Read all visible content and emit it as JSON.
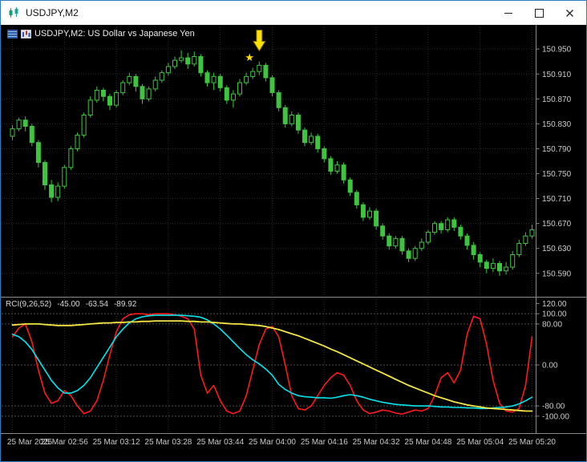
{
  "window": {
    "title": "USDJPY,M2",
    "icon": "chart-window-icon",
    "controls": [
      "minimize",
      "maximize",
      "close"
    ]
  },
  "chart": {
    "symbol_label": "USDJPY,M2:  US Dollar vs Japanese Yen",
    "corner_icons": [
      "grid-icon",
      "candles-icon"
    ],
    "indicator": {
      "name": "RCI(9,26,52)",
      "value1": "-45.00",
      "value2": "-63.54",
      "value3": "-89.92"
    }
  },
  "chart_data": {
    "type": "candlestick",
    "symbol": "USDJPY",
    "timeframe": "M2",
    "title": "USDJPY,M2: US Dollar vs Japanese Yen",
    "colors": {
      "background": "#000000",
      "bull_fill": "#000000",
      "bear_fill": "#3FC43F",
      "candle_border": "#3FC43F",
      "grid": "#2D2D2D",
      "level": "#4F4F4F",
      "separator": "#8A8A8A",
      "axis_text": "#CCCCCC"
    },
    "price_pane": {
      "ylim": [
        150.555,
        150.985
      ],
      "grid_labels": [
        "150.950",
        "150.910",
        "150.870",
        "150.830",
        "150.790",
        "150.750",
        "150.710",
        "150.670",
        "150.630",
        "150.590"
      ]
    },
    "time_axis": {
      "candles_per_label": 8,
      "labels": [
        "25 Mar 2025",
        "25 Mar 02:56",
        "25 Mar 03:12",
        "25 Mar 03:28",
        "25 Mar 03:44",
        "25 Mar 04:00",
        "25 Mar 04:16",
        "25 Mar 04:32",
        "25 Mar 04:48",
        "25 Mar 05:04",
        "25 Mar 05:20"
      ]
    },
    "candles": [
      [
        150.81,
        150.828,
        150.804,
        150.822
      ],
      [
        150.822,
        150.84,
        150.818,
        150.836
      ],
      [
        150.836,
        150.842,
        150.818,
        150.826
      ],
      [
        150.826,
        150.83,
        150.794,
        150.8
      ],
      [
        150.8,
        150.804,
        150.76,
        150.768
      ],
      [
        150.768,
        150.772,
        150.724,
        150.732
      ],
      [
        150.732,
        150.74,
        150.704,
        150.712
      ],
      [
        150.712,
        150.736,
        150.706,
        150.73
      ],
      [
        150.73,
        150.764,
        150.726,
        150.76
      ],
      [
        150.76,
        150.794,
        150.756,
        150.79
      ],
      [
        150.79,
        150.816,
        150.786,
        150.812
      ],
      [
        150.812,
        150.848,
        150.808,
        150.844
      ],
      [
        150.844,
        150.874,
        150.84,
        150.868
      ],
      [
        150.868,
        150.89,
        150.864,
        150.884
      ],
      [
        150.884,
        150.888,
        150.866,
        150.874
      ],
      [
        150.874,
        150.878,
        150.852,
        150.86
      ],
      [
        150.86,
        150.884,
        150.856,
        150.88
      ],
      [
        150.88,
        150.9,
        150.876,
        150.896
      ],
      [
        150.896,
        150.912,
        150.892,
        150.906
      ],
      [
        150.906,
        150.91,
        150.882,
        150.89
      ],
      [
        150.89,
        150.894,
        150.862,
        150.87
      ],
      [
        150.87,
        150.89,
        150.866,
        150.886
      ],
      [
        150.886,
        150.906,
        150.882,
        150.9
      ],
      [
        150.9,
        150.916,
        150.896,
        150.912
      ],
      [
        150.912,
        150.928,
        150.908,
        150.922
      ],
      [
        150.922,
        150.938,
        150.918,
        150.932
      ],
      [
        150.932,
        150.948,
        150.928,
        150.936
      ],
      [
        150.936,
        150.944,
        150.918,
        150.926
      ],
      [
        150.926,
        150.946,
        150.922,
        150.938
      ],
      [
        150.938,
        150.942,
        150.906,
        150.912
      ],
      [
        150.912,
        150.916,
        150.89,
        150.896
      ],
      [
        150.896,
        150.912,
        150.884,
        150.906
      ],
      [
        150.906,
        150.91,
        150.882,
        150.888
      ],
      [
        150.888,
        150.892,
        150.862,
        150.868
      ],
      [
        150.868,
        150.884,
        150.856,
        150.878
      ],
      [
        150.878,
        150.902,
        150.874,
        150.896
      ],
      [
        150.896,
        150.912,
        150.892,
        150.906
      ],
      [
        150.906,
        150.92,
        150.902,
        150.914
      ],
      [
        150.914,
        150.93,
        150.908,
        150.924
      ],
      [
        150.924,
        150.928,
        150.898,
        150.904
      ],
      [
        150.904,
        150.908,
        150.874,
        150.88
      ],
      [
        150.88,
        150.884,
        150.85,
        150.856
      ],
      [
        150.856,
        150.86,
        150.824,
        150.83
      ],
      [
        150.83,
        150.85,
        150.826,
        150.844
      ],
      [
        150.844,
        150.848,
        150.814,
        150.82
      ],
      [
        150.82,
        150.824,
        150.794,
        150.8
      ],
      [
        150.8,
        150.816,
        150.796,
        150.81
      ],
      [
        150.81,
        150.814,
        150.784,
        150.79
      ],
      [
        150.79,
        150.794,
        150.768,
        150.774
      ],
      [
        150.774,
        150.778,
        150.748,
        150.754
      ],
      [
        150.754,
        150.77,
        150.75,
        150.764
      ],
      [
        150.764,
        150.768,
        150.734,
        150.74
      ],
      [
        150.74,
        150.744,
        150.714,
        150.72
      ],
      [
        150.72,
        150.724,
        150.694,
        150.7
      ],
      [
        150.7,
        150.704,
        150.674,
        150.68
      ],
      [
        150.68,
        150.696,
        150.676,
        150.69
      ],
      [
        150.69,
        150.694,
        150.66,
        150.666
      ],
      [
        150.666,
        150.67,
        150.644,
        150.65
      ],
      [
        150.65,
        150.654,
        150.628,
        150.634
      ],
      [
        150.634,
        150.65,
        150.63,
        150.646
      ],
      [
        150.646,
        150.65,
        150.62,
        150.626
      ],
      [
        150.626,
        150.63,
        150.608,
        150.614
      ],
      [
        150.614,
        150.634,
        150.61,
        150.63
      ],
      [
        150.63,
        150.646,
        150.626,
        150.64
      ],
      [
        150.64,
        150.66,
        150.636,
        150.656
      ],
      [
        150.656,
        150.674,
        150.652,
        150.67
      ],
      [
        150.67,
        150.674,
        150.654,
        150.66
      ],
      [
        150.66,
        150.68,
        150.656,
        150.676
      ],
      [
        150.676,
        150.68,
        150.658,
        150.664
      ],
      [
        150.664,
        150.668,
        150.644,
        150.65
      ],
      [
        150.65,
        150.654,
        150.628,
        150.635
      ],
      [
        150.635,
        150.64,
        150.612,
        150.62
      ],
      [
        150.62,
        150.624,
        150.6,
        150.608
      ],
      [
        150.608,
        150.612,
        150.59,
        150.598
      ],
      [
        150.598,
        150.614,
        150.592,
        150.606
      ],
      [
        150.606,
        150.61,
        150.586,
        150.594
      ],
      [
        150.594,
        150.608,
        150.588,
        150.6
      ],
      [
        150.6,
        150.626,
        150.596,
        150.62
      ],
      [
        150.62,
        150.644,
        150.616,
        150.638
      ],
      [
        150.638,
        150.656,
        150.634,
        150.65
      ],
      [
        150.65,
        150.668,
        150.646,
        150.66
      ]
    ],
    "indicator": {
      "name": "RCI",
      "params": [
        9,
        26,
        52
      ],
      "last_values": [
        -45.0,
        -63.54,
        -89.92
      ],
      "ylim": [
        -130,
        130
      ],
      "grid_labels": [
        "120.00",
        "100.00",
        "80.00",
        "0.00",
        "-80.00",
        "-100.00"
      ],
      "level_lines": [
        100,
        80,
        0,
        -80,
        -100
      ],
      "series": [
        {
          "name": "rci-9",
          "color": "#FF1A1A",
          "width": 1.6,
          "values": [
            55,
            72,
            80,
            45,
            -10,
            -55,
            -75,
            -70,
            -50,
            -60,
            -80,
            -95,
            -90,
            -70,
            -30,
            20,
            65,
            90,
            98,
            100,
            100,
            98,
            100,
            100,
            100,
            98,
            95,
            90,
            70,
            -20,
            -55,
            -40,
            -70,
            -90,
            -95,
            -90,
            -60,
            -10,
            40,
            70,
            75,
            55,
            0,
            -60,
            -85,
            -88,
            -80,
            -60,
            -40,
            -25,
            -15,
            -20,
            -40,
            -70,
            -88,
            -95,
            -92,
            -88,
            -90,
            -94,
            -96,
            -92,
            -88,
            -90,
            -85,
            -60,
            -25,
            -15,
            -35,
            -10,
            60,
            95,
            90,
            40,
            -30,
            -75,
            -90,
            -92,
            -85,
            -40,
            55
          ]
        },
        {
          "name": "rci-26",
          "color": "#00E5EE",
          "width": 1.6,
          "values": [
            60,
            55,
            45,
            30,
            10,
            -10,
            -30,
            -45,
            -55,
            -55,
            -50,
            -40,
            -25,
            -5,
            15,
            35,
            55,
            70,
            82,
            90,
            94,
            96,
            97,
            97,
            97,
            97,
            97,
            96,
            95,
            93,
            88,
            80,
            70,
            58,
            45,
            32,
            20,
            10,
            2,
            -8,
            -20,
            -38,
            -48,
            -55,
            -60,
            -62,
            -63,
            -64,
            -64,
            -65,
            -63,
            -60,
            -58,
            -60,
            -63,
            -67,
            -70,
            -73,
            -75,
            -77,
            -78,
            -79,
            -80,
            -80,
            -80,
            -81,
            -82,
            -82,
            -83,
            -83,
            -84,
            -84,
            -85,
            -85,
            -84,
            -83,
            -82,
            -80,
            -76,
            -70,
            -63
          ]
        },
        {
          "name": "rci-52",
          "color": "#F5E642",
          "width": 1.8,
          "values": [
            78,
            79,
            80,
            80,
            80,
            79,
            78,
            77,
            77,
            77,
            78,
            79,
            80,
            81,
            82,
            82,
            83,
            83,
            84,
            84,
            85,
            85,
            86,
            86,
            86,
            86,
            86,
            85,
            85,
            84,
            84,
            83,
            82,
            81,
            80,
            80,
            79,
            78,
            77,
            75,
            72,
            69,
            65,
            61,
            57,
            52,
            47,
            42,
            37,
            31,
            26,
            20,
            14,
            8,
            2,
            -4,
            -10,
            -16,
            -22,
            -28,
            -34,
            -40,
            -45,
            -50,
            -55,
            -60,
            -64,
            -68,
            -72,
            -75,
            -78,
            -80,
            -82,
            -84,
            -85,
            -86,
            -87,
            -88,
            -89,
            -90,
            -90
          ]
        }
      ]
    },
    "annotations": {
      "arrow_down": {
        "candle_index": 38,
        "tip_price": 150.947,
        "color": "#FFE100"
      },
      "star": {
        "candle_index": 37,
        "price": 150.936,
        "color": "#FFE100",
        "glyph": "★"
      }
    }
  }
}
